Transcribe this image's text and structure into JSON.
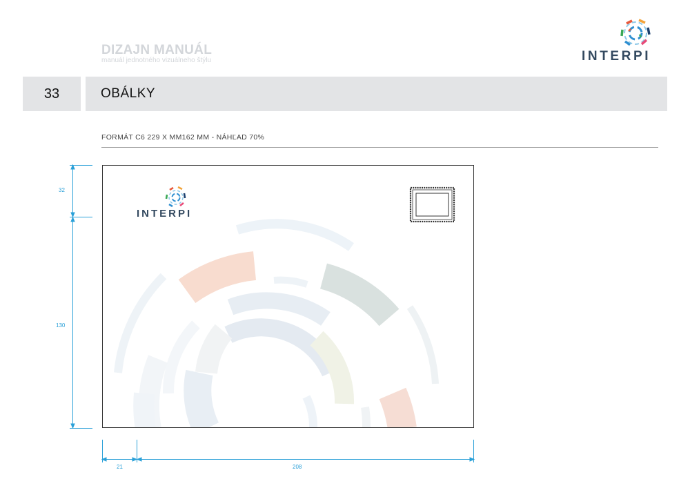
{
  "header": {
    "manual_title": "DIZAJN MANUÁL",
    "manual_subtitle": "manuál jednotného vizuálneho štýlu",
    "brand": "INTERPI"
  },
  "section": {
    "page_number": "33",
    "title": "OBÁLKY"
  },
  "format_label": "FORMÁT C6 229 X MM162 MM - NÁHĽAD 70%",
  "envelope": {
    "brand": "INTERPI"
  },
  "dimensions": {
    "top_margin": "32",
    "height_rest": "130",
    "left_margin": "21",
    "width_rest": "208"
  },
  "colors": {
    "brand_text": "#33495f",
    "dimension_lines": "#2aa0d8",
    "header_band": "#e3e4e6",
    "logo_segments": [
      "#e85a3c",
      "#f2a33a",
      "#2f8fd1",
      "#3aa856",
      "#1b3f6e",
      "#e84b78",
      "#8ec9e8"
    ]
  }
}
